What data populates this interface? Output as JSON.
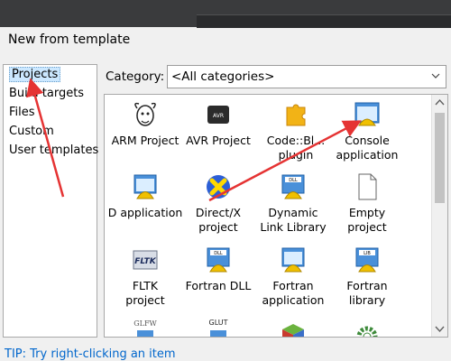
{
  "dialog": {
    "title": "New from template"
  },
  "categories": [
    "Projects",
    "Build targets",
    "Files",
    "Custom",
    "User templates"
  ],
  "filter": {
    "label": "Category:",
    "selected": "<All categories>"
  },
  "templates": [
    {
      "label": "ARM Project",
      "icon": "gnu-icon"
    },
    {
      "label": "AVR Project",
      "icon": "avr-chip-icon"
    },
    {
      "label": "Code::Bl...\nplugin",
      "icon": "puzzle-icon"
    },
    {
      "label": "Console\napplication",
      "icon": "console-icon"
    },
    {
      "label": "D application",
      "icon": "app-icon"
    },
    {
      "label": "Direct/X\nproject",
      "icon": "directx-icon"
    },
    {
      "label": "Dynamic\nLink Library",
      "icon": "dll-icon"
    },
    {
      "label": "Empty\nproject",
      "icon": "blank-document-icon"
    },
    {
      "label": "FLTK\nproject",
      "icon": "fltk-icon"
    },
    {
      "label": "Fortran DLL",
      "icon": "dll-icon"
    },
    {
      "label": "Fortran\napplication",
      "icon": "app-icon"
    },
    {
      "label": "Fortran\nlibrary",
      "icon": "lib-icon"
    },
    {
      "label": "",
      "icon": "glfw-icon",
      "icon_text": "GLFW"
    },
    {
      "label": "",
      "icon": "glut-icon",
      "icon_text": "GLUT"
    },
    {
      "label": "",
      "icon": "gtk-icon"
    },
    {
      "label": "",
      "icon": "gear-icon"
    }
  ],
  "tip": "TIP: Try right-clicking an item",
  "colors": {
    "annotation": "#e53333",
    "tip": "#0066cc",
    "selection": "#cce8ff"
  }
}
